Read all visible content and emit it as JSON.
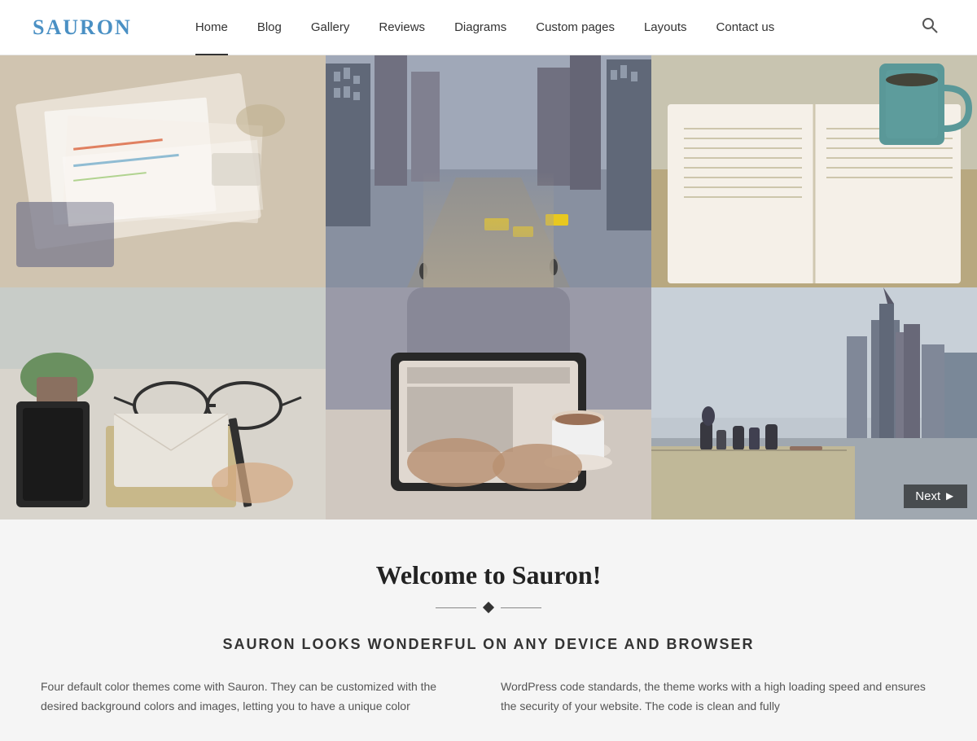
{
  "header": {
    "logo": {
      "prefix": "S",
      "rest": "AURON"
    },
    "nav": {
      "items": [
        {
          "label": "Home",
          "active": true
        },
        {
          "label": "Blog",
          "active": false
        },
        {
          "label": "Gallery",
          "active": false
        },
        {
          "label": "Reviews",
          "active": false
        },
        {
          "label": "Diagrams",
          "active": false
        },
        {
          "label": "Custom pages",
          "active": false
        },
        {
          "label": "Layouts",
          "active": false
        },
        {
          "label": "Contact us",
          "active": false
        }
      ]
    },
    "search_icon": "🔍"
  },
  "gallery": {
    "next_label": "Next",
    "cells": [
      {
        "id": 1,
        "type": "desk",
        "alt": "Desk with papers and markers"
      },
      {
        "id": 2,
        "type": "city",
        "alt": "City street with tall buildings"
      },
      {
        "id": 3,
        "type": "book-coffee",
        "alt": "Open book with coffee cup"
      },
      {
        "id": 4,
        "type": "workspace",
        "alt": "Workspace with glasses and phone"
      },
      {
        "id": 5,
        "type": "tablet",
        "alt": "Person using tablet with coffee"
      },
      {
        "id": 6,
        "type": "skyline",
        "alt": "City skyline with people"
      }
    ]
  },
  "welcome": {
    "title": "Welcome to Sauron!",
    "sub_heading": "SAURON LOOKS WONDERFUL ON ANY DEVICE AND BROWSER",
    "col1_text": "Four default color themes come with Sauron. They can be customized with the desired background colors and images, letting you to have a unique color",
    "col2_text": "WordPress code standards, the theme works with a high loading speed and ensures the security of your website. The code is clean and fully"
  }
}
